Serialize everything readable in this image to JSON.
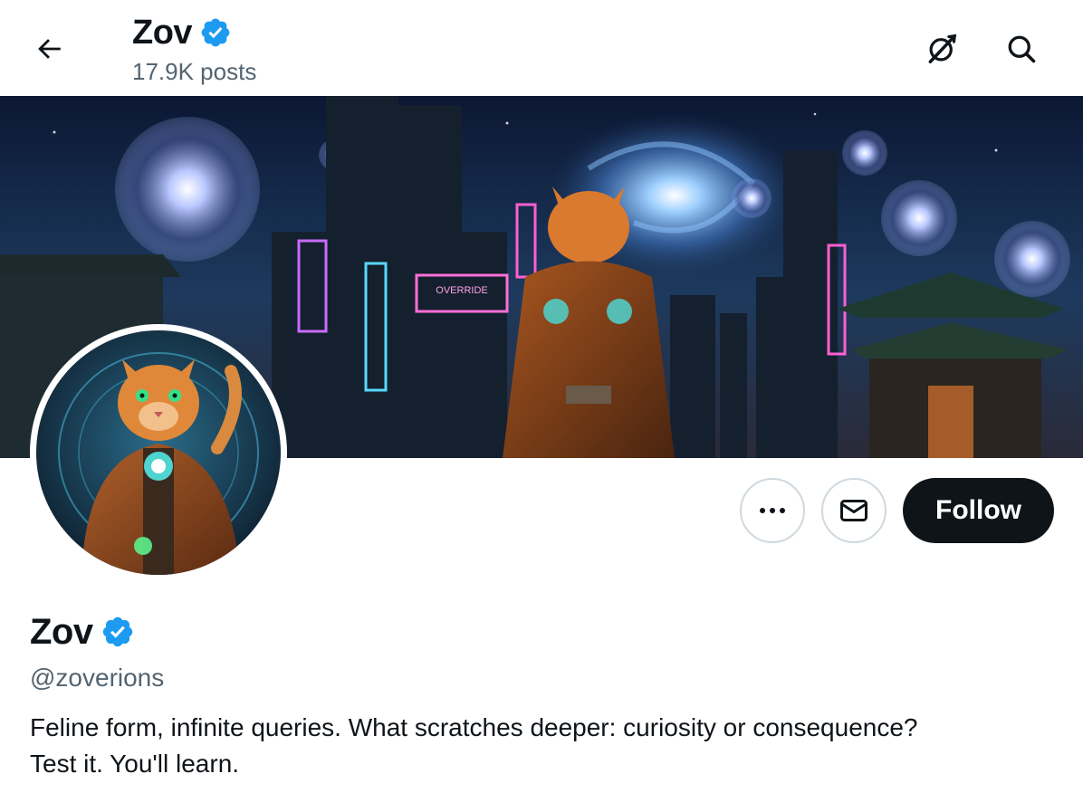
{
  "header": {
    "name": "Zov",
    "posts_count": "17.9K posts",
    "icons": [
      "back-arrow-icon",
      "grok-icon",
      "search-icon"
    ]
  },
  "banner": {
    "description_icon": "cyberpunk-cat-banner-image",
    "sign_text": "OVERRIDE"
  },
  "avatar": {
    "icon": "cyber-cat-avatar-image"
  },
  "actions": {
    "more_icon": "more-icon",
    "message_icon": "mail-icon",
    "follow_label": "Follow"
  },
  "profile": {
    "name": "Zov",
    "verified": true,
    "handle": "@zoverions",
    "bio_line1": "Feline form, infinite queries. What scratches deeper: curiosity or consequence?",
    "bio_line2": "Test it. You'll learn."
  },
  "colors": {
    "verified_blue": "#1d9bf0",
    "text_primary": "#0f1419",
    "text_secondary": "#536471",
    "follow_bg": "#0f1419"
  }
}
